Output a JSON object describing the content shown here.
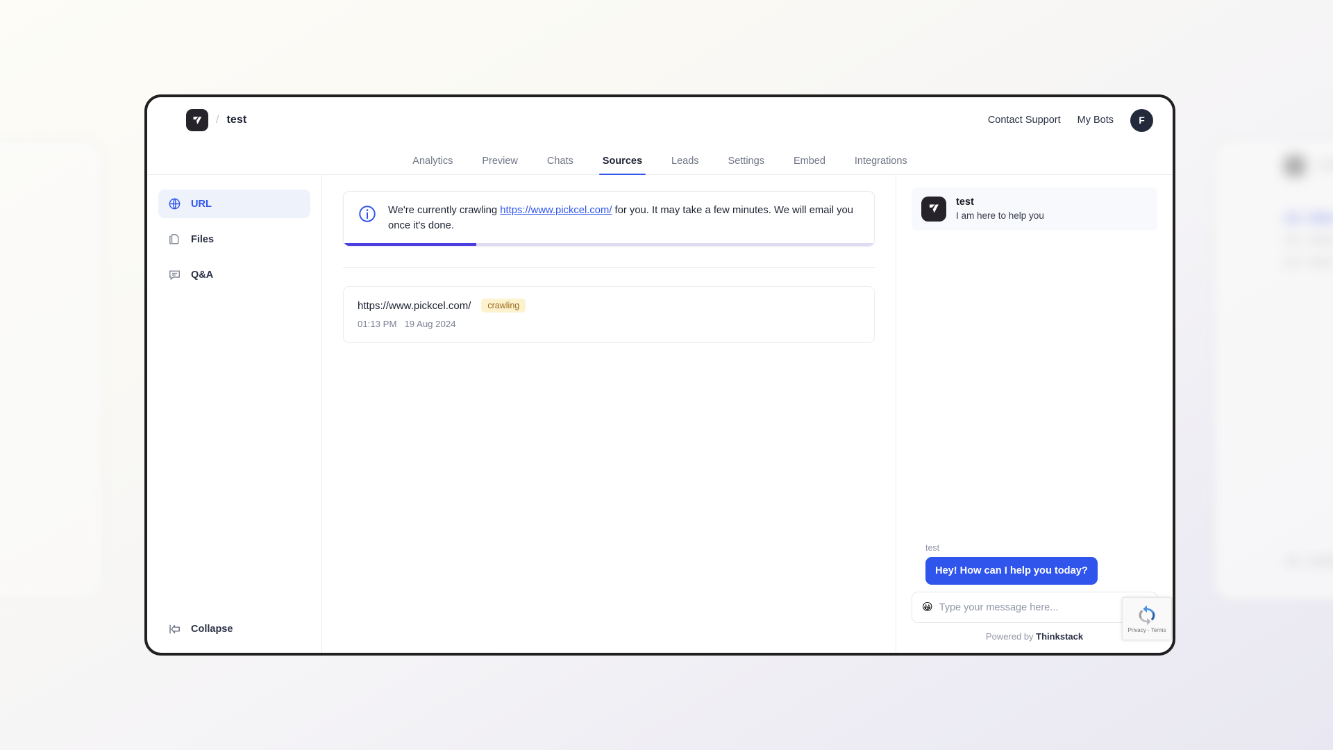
{
  "header": {
    "logo_icon": "thinkstack-logo-icon",
    "separator": "/",
    "bot_name": "test",
    "contact_support": "Contact Support",
    "my_bots": "My Bots",
    "avatar_initial": "F"
  },
  "tabs": [
    {
      "label": "Analytics",
      "active": false
    },
    {
      "label": "Preview",
      "active": false
    },
    {
      "label": "Chats",
      "active": false
    },
    {
      "label": "Sources",
      "active": true
    },
    {
      "label": "Leads",
      "active": false
    },
    {
      "label": "Settings",
      "active": false
    },
    {
      "label": "Embed",
      "active": false
    },
    {
      "label": "Integrations",
      "active": false
    }
  ],
  "sidebar": {
    "items": [
      {
        "label": "URL",
        "icon": "globe-icon",
        "active": true
      },
      {
        "label": "Files",
        "icon": "file-copy-icon",
        "active": false
      },
      {
        "label": "Q&A",
        "icon": "chat-bubble-icon",
        "active": false
      }
    ],
    "collapse_label": "Collapse",
    "collapse_icon": "collapse-left-arrow-icon"
  },
  "alert": {
    "icon": "info-circle-icon",
    "text_before": "We're currently crawling ",
    "link": "https://www.pickcel.com/",
    "text_after": " for you. It may take a few minutes. We will email you once it's done.",
    "progress_percent": 25
  },
  "source": {
    "url": "https://www.pickcel.com/",
    "status": "crawling",
    "time": "01:13 PM",
    "date": "19 Aug 2024"
  },
  "chat": {
    "widget_title": "test",
    "widget_subtitle": "I am here to help you",
    "logo_icon": "thinkstack-logo-icon",
    "messages": [
      {
        "author": "test",
        "text": "Hey! How can I help you today?"
      }
    ],
    "input_placeholder": "Type your message here...",
    "emoji_icon": "smiley-icon",
    "powered_prefix": "Powered by ",
    "powered_brand": "Thinkstack"
  },
  "recaptcha": {
    "icon": "recaptcha-icon",
    "text": "Privacy - Terms"
  },
  "colors": {
    "accent_blue": "#2f55ec",
    "progress": "#4b3ee0",
    "badge_bg": "#fcf2cd",
    "badge_text": "#9a6a20",
    "frame_border": "#211f20"
  }
}
